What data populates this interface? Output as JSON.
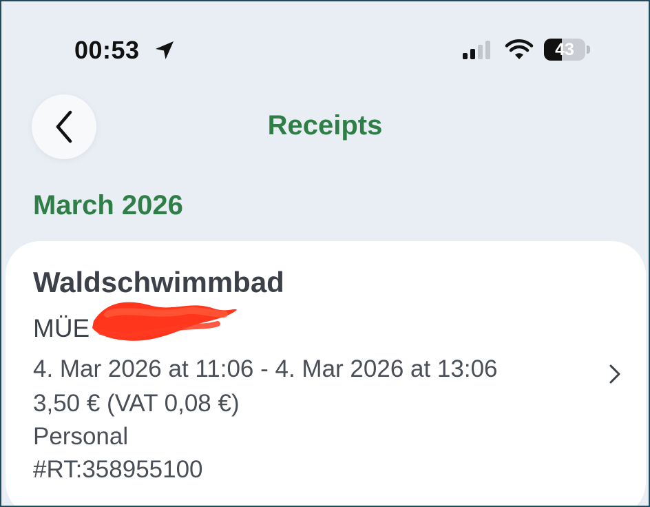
{
  "status_bar": {
    "time": "00:53",
    "battery_level": "43",
    "battery_fraction": 0.43,
    "icons": [
      "location-arrow-icon",
      "cellular-signal-icon",
      "wifi-icon",
      "battery-icon"
    ]
  },
  "nav": {
    "title": "Receipts",
    "back_icon": "chevron-left-icon"
  },
  "section": {
    "title": "March 2026"
  },
  "receipt": {
    "merchant": "Waldschwimmbad",
    "location_visible": "MÜE",
    "time_range": "4. Mar 2026 at 11:06 - 4. Mar 2026 at 13:06",
    "amount": "3,50 € (VAT 0,08 €)",
    "category": "Personal",
    "reference": "#RT:358955100",
    "open_icon": "chevron-right-icon"
  },
  "colors": {
    "accent": "#2f7d47",
    "background": "#e9eef4",
    "card": "#ffffff",
    "redaction": "#ff2a10"
  }
}
